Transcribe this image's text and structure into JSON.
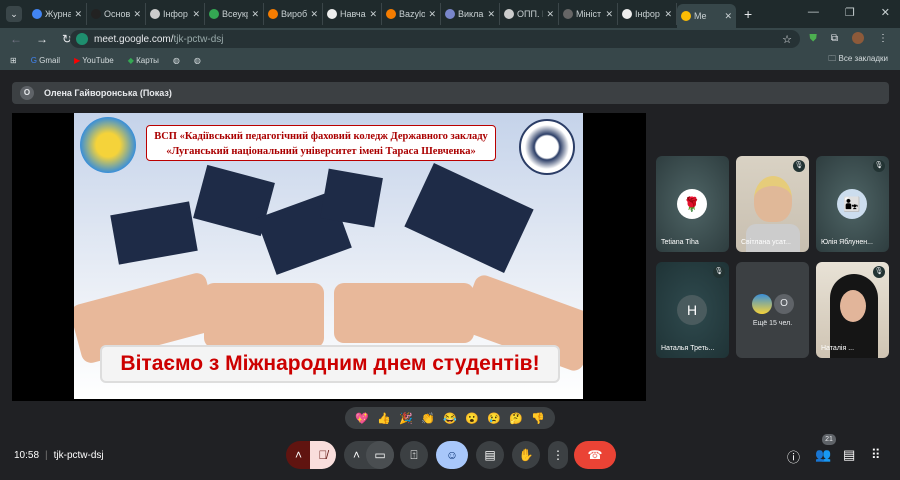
{
  "browser": {
    "tabs": [
      {
        "label": "Журна",
        "color": "#4285f4"
      },
      {
        "label": "Основ",
        "color": "#222"
      },
      {
        "label": "Інфор",
        "color": "#ccc"
      },
      {
        "label": "Всеукр",
        "color": "#34a853"
      },
      {
        "label": "Вироб",
        "color": "#f57c00"
      },
      {
        "label": "Навча",
        "color": "#eee"
      },
      {
        "label": "Bazylo",
        "color": "#f57c00"
      },
      {
        "label": "Викла",
        "color": "#7986cb"
      },
      {
        "label": "ОПП. І",
        "color": "#ccc"
      },
      {
        "label": "Мініст",
        "color": "#666"
      },
      {
        "label": "Інфор",
        "color": "#eee"
      },
      {
        "label": "Me",
        "color": "#fbbc04"
      }
    ],
    "url_host": "meet.google.com/",
    "url_path": "tjk-pctw-dsj",
    "bookmarks": [
      "Gmail",
      "YouTube",
      "Карты"
    ],
    "all_bookmarks": "Все закладки"
  },
  "meet": {
    "presenter_initial": "О",
    "presenter": "Олена Гайворонська (Показ)",
    "slide": {
      "line1": "ВСП «Кадіївський педагогічний фаховий коледж Державного закладу",
      "line2": "«Луганський національний університет імені Тараса Шевченка»",
      "greeting": "Вітаємо з Міжнародним днем студентів!"
    },
    "participants": [
      {
        "name": "Tetiana Tiha"
      },
      {
        "name": "Світлана усат..."
      },
      {
        "name": "Юлія Яблунен..."
      },
      {
        "name": "Наталья Треть...",
        "initial": "H"
      },
      {
        "name": "Ещё 15 чел.",
        "initial": "О"
      },
      {
        "name": "Наталія ..."
      }
    ],
    "reactions": [
      "💖",
      "👍",
      "🎉",
      "👏",
      "😂",
      "😮",
      "😢",
      "🤔",
      "👎"
    ],
    "time": "10:58",
    "code": "tjk-pctw-dsj",
    "participant_count": "21",
    "colors": {
      "end_call": "#ea4335",
      "mic_off": "#f9dedc",
      "active": "#a8c7fa"
    }
  }
}
